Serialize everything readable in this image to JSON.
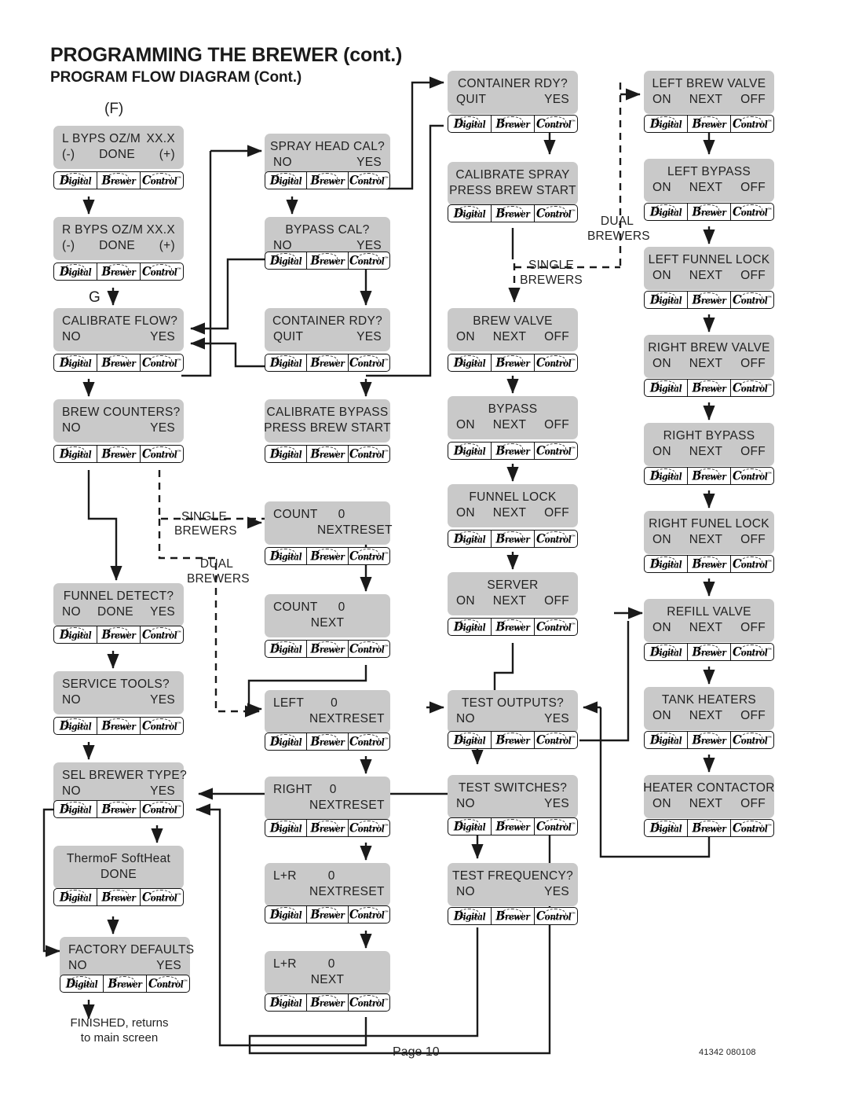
{
  "header": {
    "title": "PROGRAMMING THE BREWER (cont.)",
    "subtitle": "PROGRAM FLOW DIAGRAM (Cont.)"
  },
  "tags": {
    "f": "(F)",
    "g": "G"
  },
  "logo": {
    "word1": "Digital",
    "word2": "Brewer",
    "word3": "Control",
    "tm": "™"
  },
  "branch_labels": {
    "single_1": "SINGLE",
    "single_1b": "BREWERS",
    "dual_1": "DUAL",
    "dual_1b": "BREWERS",
    "single_2": "SINGLE",
    "single_2b": "BREWERS",
    "dual_2": "DUAL",
    "dual_2b": "BREWERS"
  },
  "footer": {
    "finished_line1": "FINISHED, returns",
    "finished_line2": "to main screen",
    "page": "Page 10",
    "doc_code": "41342 080108"
  },
  "nodes": {
    "lbyps": {
      "l1a": "L BYPS OZ/M",
      "l1b": "XX.X",
      "l2a": "(-)",
      "l2b": "DONE",
      "l2c": "(+)"
    },
    "rbyps": {
      "l1a": "R BYPS OZ/M",
      "l1b": "XX.X",
      "l2a": "(-)",
      "l2b": "DONE",
      "l2c": "(+)"
    },
    "calflow": {
      "l1": "CALIBRATE  FLOW?",
      "l2a": "NO",
      "l2b": "YES"
    },
    "brewcount": {
      "l1": "BREW  COUNTERS?",
      "l2a": "NO",
      "l2b": "YES"
    },
    "funneldet": {
      "l1": "FUNNEL DETECT?",
      "l2a": "NO",
      "l2b": "DONE",
      "l2c": "YES"
    },
    "servtools": {
      "l1": "SERVICE  TOOLS?",
      "l2a": "NO",
      "l2b": "YES"
    },
    "selbrewer": {
      "l1": "SEL BREWER TYPE?",
      "l2a": "NO",
      "l2b": "YES"
    },
    "thermof": {
      "l1": "ThermoF  SoftHeat",
      "l2": "DONE"
    },
    "factory": {
      "l1": "FACTORY  DEFAULTS",
      "l2a": "NO",
      "l2b": "YES"
    },
    "sprayhead": {
      "l1": "SPRAY  HEAD  CAL?",
      "l2a": "NO",
      "l2b": "YES"
    },
    "bypasscal": {
      "l1": "BYPASS  CAL?",
      "l2a": "NO",
      "l2b": "YES"
    },
    "containerA": {
      "l1": "CONTAINER  RDY?",
      "l2a": "QUIT",
      "l2b": "YES"
    },
    "calbypass": {
      "l1": "CALIBRATE  BYPASS",
      "l2": "PRESS  BREW  START"
    },
    "count1": {
      "l1a": "COUNT",
      "l1b": "0",
      "l2a": "NEXT",
      "l2b": "RESET"
    },
    "count2": {
      "l1a": "COUNT",
      "l1b": "0",
      "l2a": "NEXT"
    },
    "left": {
      "l1a": "LEFT",
      "l1b": "0",
      "l2a": "NEXT",
      "l2b": "RESET"
    },
    "right": {
      "l1a": "RIGHT",
      "l1b": "0",
      "l2a": "NEXT",
      "l2b": "RESET"
    },
    "lr1": {
      "l1a": "L+R",
      "l1b": "0",
      "l2a": "NEXT",
      "l2b": "RESET"
    },
    "lr2": {
      "l1a": "L+R",
      "l1b": "0",
      "l2a": "NEXT"
    },
    "containerB": {
      "l1": "CONTAINER  RDY?",
      "l2a": "QUIT",
      "l2b": "YES"
    },
    "calspray": {
      "l1": "CALIBRATE  SPRAY",
      "l2": "PRESS  BREW  START"
    },
    "brewvalve": {
      "l1": "BREW  VALVE",
      "l2a": "ON",
      "l2b": "NEXT",
      "l2c": "OFF"
    },
    "bypass": {
      "l1": "BYPASS",
      "l2a": "ON",
      "l2b": "NEXT",
      "l2c": "OFF"
    },
    "funnellock": {
      "l1": "FUNNEL  LOCK",
      "l2a": "ON",
      "l2b": "NEXT",
      "l2c": "OFF"
    },
    "server": {
      "l1": "SERVER",
      "l2a": "ON",
      "l2b": "NEXT",
      "l2c": "OFF"
    },
    "testout": {
      "l1": "TEST  OUTPUTS?",
      "l2a": "NO",
      "l2b": "YES"
    },
    "testsw": {
      "l1": "TEST  SWITCHES?",
      "l2a": "NO",
      "l2b": "YES"
    },
    "testfreq": {
      "l1": "TEST  FREQUENCY?",
      "l2a": "NO",
      "l2b": "YES"
    },
    "lbrewvalve": {
      "l1": "LEFT  BREW  VALVE",
      "l2a": "ON",
      "l2b": "NEXT",
      "l2c": "OFF"
    },
    "lbypass": {
      "l1": "LEFT  BYPASS",
      "l2a": "ON",
      "l2b": "NEXT",
      "l2c": "OFF"
    },
    "lfunnel": {
      "l1": "LEFT  FUNNEL  LOCK",
      "l2a": "ON",
      "l2b": "NEXT",
      "l2c": "OFF"
    },
    "rbrewvalve": {
      "l1": "RIGHT  BREW  VALVE",
      "l2a": "ON",
      "l2b": "NEXT",
      "l2c": "OFF"
    },
    "rbypass": {
      "l1": "RIGHT  BYPASS",
      "l2a": "ON",
      "l2b": "NEXT",
      "l2c": "OFF"
    },
    "rfunnel": {
      "l1": "RIGHT  FUNEL  LOCK",
      "l2a": "ON",
      "l2b": "NEXT",
      "l2c": "OFF"
    },
    "refill": {
      "l1": "REFILL  VALVE",
      "l2a": "ON",
      "l2b": "NEXT",
      "l2c": "OFF"
    },
    "tankheat": {
      "l1": "TANK  HEATERS",
      "l2a": "ON",
      "l2b": "NEXT",
      "l2c": "OFF"
    },
    "heatcont": {
      "l1": "HEATER  CONTACTOR",
      "l2a": "ON",
      "l2b": "NEXT",
      "l2c": "OFF"
    }
  }
}
